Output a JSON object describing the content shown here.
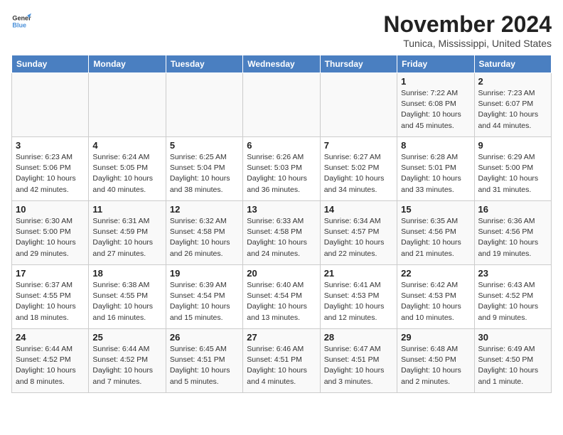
{
  "header": {
    "logo_line1": "General",
    "logo_line2": "Blue",
    "title": "November 2024",
    "subtitle": "Tunica, Mississippi, United States"
  },
  "weekdays": [
    "Sunday",
    "Monday",
    "Tuesday",
    "Wednesday",
    "Thursday",
    "Friday",
    "Saturday"
  ],
  "weeks": [
    [
      {
        "day": "",
        "empty": true
      },
      {
        "day": "",
        "empty": true
      },
      {
        "day": "",
        "empty": true
      },
      {
        "day": "",
        "empty": true
      },
      {
        "day": "",
        "empty": true
      },
      {
        "day": "1",
        "sunrise": "Sunrise: 7:22 AM",
        "sunset": "Sunset: 6:08 PM",
        "daylight": "Daylight: 10 hours and 45 minutes."
      },
      {
        "day": "2",
        "sunrise": "Sunrise: 7:23 AM",
        "sunset": "Sunset: 6:07 PM",
        "daylight": "Daylight: 10 hours and 44 minutes."
      }
    ],
    [
      {
        "day": "3",
        "sunrise": "Sunrise: 6:23 AM",
        "sunset": "Sunset: 5:06 PM",
        "daylight": "Daylight: 10 hours and 42 minutes."
      },
      {
        "day": "4",
        "sunrise": "Sunrise: 6:24 AM",
        "sunset": "Sunset: 5:05 PM",
        "daylight": "Daylight: 10 hours and 40 minutes."
      },
      {
        "day": "5",
        "sunrise": "Sunrise: 6:25 AM",
        "sunset": "Sunset: 5:04 PM",
        "daylight": "Daylight: 10 hours and 38 minutes."
      },
      {
        "day": "6",
        "sunrise": "Sunrise: 6:26 AM",
        "sunset": "Sunset: 5:03 PM",
        "daylight": "Daylight: 10 hours and 36 minutes."
      },
      {
        "day": "7",
        "sunrise": "Sunrise: 6:27 AM",
        "sunset": "Sunset: 5:02 PM",
        "daylight": "Daylight: 10 hours and 34 minutes."
      },
      {
        "day": "8",
        "sunrise": "Sunrise: 6:28 AM",
        "sunset": "Sunset: 5:01 PM",
        "daylight": "Daylight: 10 hours and 33 minutes."
      },
      {
        "day": "9",
        "sunrise": "Sunrise: 6:29 AM",
        "sunset": "Sunset: 5:00 PM",
        "daylight": "Daylight: 10 hours and 31 minutes."
      }
    ],
    [
      {
        "day": "10",
        "sunrise": "Sunrise: 6:30 AM",
        "sunset": "Sunset: 5:00 PM",
        "daylight": "Daylight: 10 hours and 29 minutes."
      },
      {
        "day": "11",
        "sunrise": "Sunrise: 6:31 AM",
        "sunset": "Sunset: 4:59 PM",
        "daylight": "Daylight: 10 hours and 27 minutes."
      },
      {
        "day": "12",
        "sunrise": "Sunrise: 6:32 AM",
        "sunset": "Sunset: 4:58 PM",
        "daylight": "Daylight: 10 hours and 26 minutes."
      },
      {
        "day": "13",
        "sunrise": "Sunrise: 6:33 AM",
        "sunset": "Sunset: 4:58 PM",
        "daylight": "Daylight: 10 hours and 24 minutes."
      },
      {
        "day": "14",
        "sunrise": "Sunrise: 6:34 AM",
        "sunset": "Sunset: 4:57 PM",
        "daylight": "Daylight: 10 hours and 22 minutes."
      },
      {
        "day": "15",
        "sunrise": "Sunrise: 6:35 AM",
        "sunset": "Sunset: 4:56 PM",
        "daylight": "Daylight: 10 hours and 21 minutes."
      },
      {
        "day": "16",
        "sunrise": "Sunrise: 6:36 AM",
        "sunset": "Sunset: 4:56 PM",
        "daylight": "Daylight: 10 hours and 19 minutes."
      }
    ],
    [
      {
        "day": "17",
        "sunrise": "Sunrise: 6:37 AM",
        "sunset": "Sunset: 4:55 PM",
        "daylight": "Daylight: 10 hours and 18 minutes."
      },
      {
        "day": "18",
        "sunrise": "Sunrise: 6:38 AM",
        "sunset": "Sunset: 4:55 PM",
        "daylight": "Daylight: 10 hours and 16 minutes."
      },
      {
        "day": "19",
        "sunrise": "Sunrise: 6:39 AM",
        "sunset": "Sunset: 4:54 PM",
        "daylight": "Daylight: 10 hours and 15 minutes."
      },
      {
        "day": "20",
        "sunrise": "Sunrise: 6:40 AM",
        "sunset": "Sunset: 4:54 PM",
        "daylight": "Daylight: 10 hours and 13 minutes."
      },
      {
        "day": "21",
        "sunrise": "Sunrise: 6:41 AM",
        "sunset": "Sunset: 4:53 PM",
        "daylight": "Daylight: 10 hours and 12 minutes."
      },
      {
        "day": "22",
        "sunrise": "Sunrise: 6:42 AM",
        "sunset": "Sunset: 4:53 PM",
        "daylight": "Daylight: 10 hours and 10 minutes."
      },
      {
        "day": "23",
        "sunrise": "Sunrise: 6:43 AM",
        "sunset": "Sunset: 4:52 PM",
        "daylight": "Daylight: 10 hours and 9 minutes."
      }
    ],
    [
      {
        "day": "24",
        "sunrise": "Sunrise: 6:44 AM",
        "sunset": "Sunset: 4:52 PM",
        "daylight": "Daylight: 10 hours and 8 minutes."
      },
      {
        "day": "25",
        "sunrise": "Sunrise: 6:44 AM",
        "sunset": "Sunset: 4:52 PM",
        "daylight": "Daylight: 10 hours and 7 minutes."
      },
      {
        "day": "26",
        "sunrise": "Sunrise: 6:45 AM",
        "sunset": "Sunset: 4:51 PM",
        "daylight": "Daylight: 10 hours and 5 minutes."
      },
      {
        "day": "27",
        "sunrise": "Sunrise: 6:46 AM",
        "sunset": "Sunset: 4:51 PM",
        "daylight": "Daylight: 10 hours and 4 minutes."
      },
      {
        "day": "28",
        "sunrise": "Sunrise: 6:47 AM",
        "sunset": "Sunset: 4:51 PM",
        "daylight": "Daylight: 10 hours and 3 minutes."
      },
      {
        "day": "29",
        "sunrise": "Sunrise: 6:48 AM",
        "sunset": "Sunset: 4:50 PM",
        "daylight": "Daylight: 10 hours and 2 minutes."
      },
      {
        "day": "30",
        "sunrise": "Sunrise: 6:49 AM",
        "sunset": "Sunset: 4:50 PM",
        "daylight": "Daylight: 10 hours and 1 minute."
      }
    ]
  ]
}
